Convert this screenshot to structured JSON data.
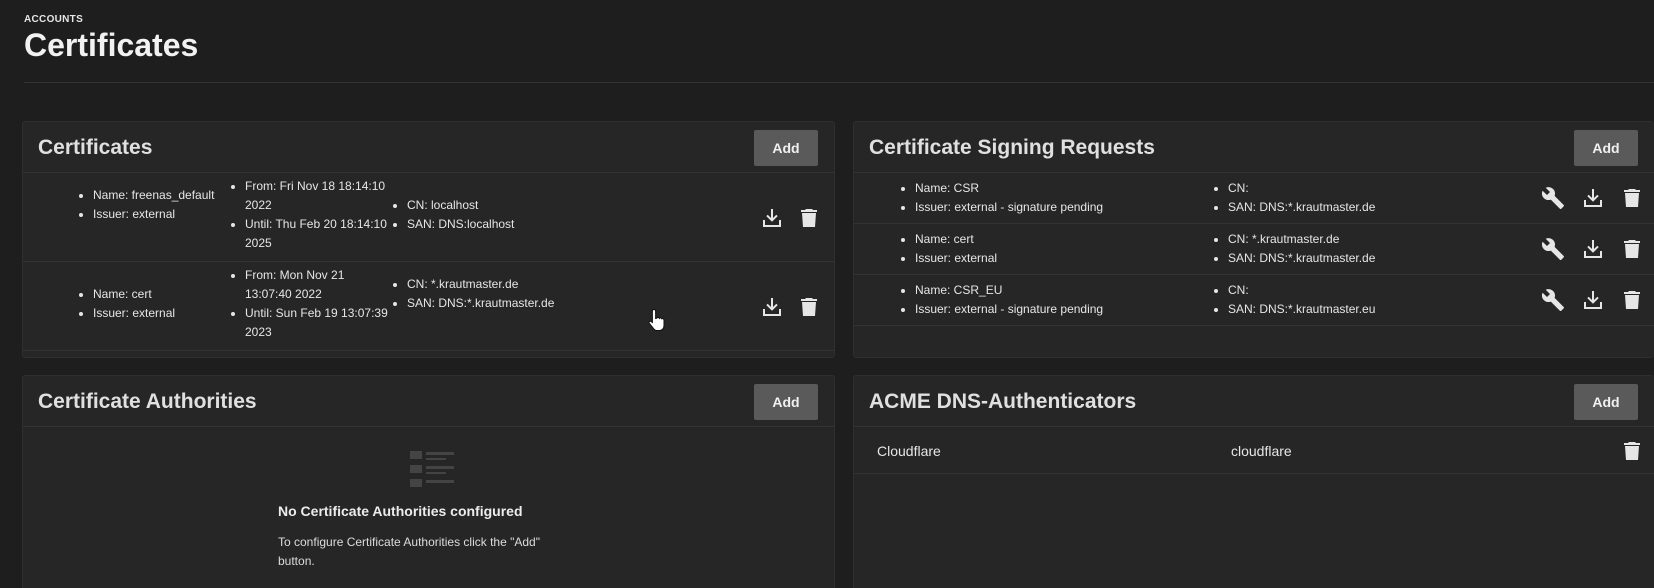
{
  "header": {
    "breadcrumb": "ACCOUNTS",
    "title": "Certificates"
  },
  "certificates": {
    "title": "Certificates",
    "add_label": "Add",
    "rows": [
      {
        "name": "Name: freenas_default",
        "issuer": "Issuer: external",
        "from": "From: Fri Nov 18 18:14:10 2022",
        "until": "Until: Thu Feb 20 18:14:10 2025",
        "cn": "CN: localhost",
        "san": "SAN: DNS:localhost"
      },
      {
        "name": "Name: cert",
        "issuer": "Issuer: external",
        "from": "From: Mon Nov 21 13:07:40 2022",
        "until": "Until: Sun Feb 19 13:07:39 2023",
        "cn": "CN: *.krautmaster.de",
        "san": "SAN: DNS:*.krautmaster.de"
      }
    ]
  },
  "csr": {
    "title": "Certificate Signing Requests",
    "add_label": "Add",
    "rows": [
      {
        "name": "Name: CSR",
        "issuer": "Issuer: external - signature pending",
        "cn": "CN:",
        "san": "SAN: DNS:*.krautmaster.de"
      },
      {
        "name": "Name: cert",
        "issuer": "Issuer: external",
        "cn": "CN: *.krautmaster.de",
        "san": "SAN: DNS:*.krautmaster.de"
      },
      {
        "name": "Name: CSR_EU",
        "issuer": "Issuer: external - signature pending",
        "cn": "CN:",
        "san": "SAN: DNS:*.krautmaster.eu"
      }
    ]
  },
  "authorities": {
    "title": "Certificate Authorities",
    "add_label": "Add",
    "empty_title": "No Certificate Authorities configured",
    "empty_text": "To configure Certificate Authorities click the \"Add\" button."
  },
  "acme": {
    "title": "ACME DNS-Authenticators",
    "add_label": "Add",
    "rows": [
      {
        "name": "Cloudflare",
        "authenticator": "cloudflare"
      }
    ]
  },
  "icons": {
    "download": "download-icon",
    "delete": "delete-icon",
    "wrench": "wrench-icon",
    "empty": "list-icon",
    "cursor": "hand-cursor-icon"
  },
  "colors": {
    "background": "#1e1e1e",
    "card": "#262626",
    "button": "#5a5a5a",
    "text": "#e6e6e6"
  }
}
